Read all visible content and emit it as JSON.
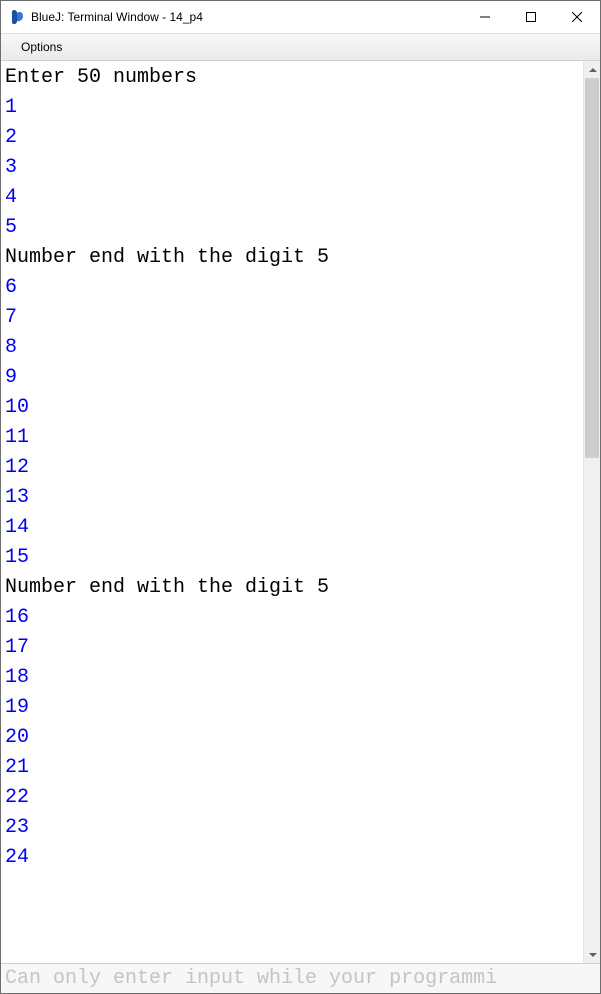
{
  "window": {
    "title": "BlueJ: Terminal Window - 14_p4"
  },
  "menu": {
    "options": "Options"
  },
  "terminal": {
    "lines": [
      {
        "kind": "sys",
        "text": "Enter 50 numbers"
      },
      {
        "kind": "inp",
        "text": "1"
      },
      {
        "kind": "inp",
        "text": "2"
      },
      {
        "kind": "inp",
        "text": "3"
      },
      {
        "kind": "inp",
        "text": "4"
      },
      {
        "kind": "inp",
        "text": "5"
      },
      {
        "kind": "sys",
        "text": "Number end with the digit 5"
      },
      {
        "kind": "inp",
        "text": "6"
      },
      {
        "kind": "inp",
        "text": "7"
      },
      {
        "kind": "inp",
        "text": "8"
      },
      {
        "kind": "inp",
        "text": "9"
      },
      {
        "kind": "inp",
        "text": "10"
      },
      {
        "kind": "inp",
        "text": "11"
      },
      {
        "kind": "inp",
        "text": "12"
      },
      {
        "kind": "inp",
        "text": "13"
      },
      {
        "kind": "inp",
        "text": "14"
      },
      {
        "kind": "inp",
        "text": "15"
      },
      {
        "kind": "sys",
        "text": "Number end with the digit 5"
      },
      {
        "kind": "inp",
        "text": "16"
      },
      {
        "kind": "inp",
        "text": "17"
      },
      {
        "kind": "inp",
        "text": "18"
      },
      {
        "kind": "inp",
        "text": "19"
      },
      {
        "kind": "inp",
        "text": "20"
      },
      {
        "kind": "inp",
        "text": "21"
      },
      {
        "kind": "inp",
        "text": "22"
      },
      {
        "kind": "inp",
        "text": "23"
      },
      {
        "kind": "inp",
        "text": "24"
      }
    ]
  },
  "status": {
    "text": "Can only enter input while your programmi"
  },
  "colors": {
    "input_text": "#0000ee",
    "system_text": "#000000",
    "status_text": "#c4c4c4"
  }
}
